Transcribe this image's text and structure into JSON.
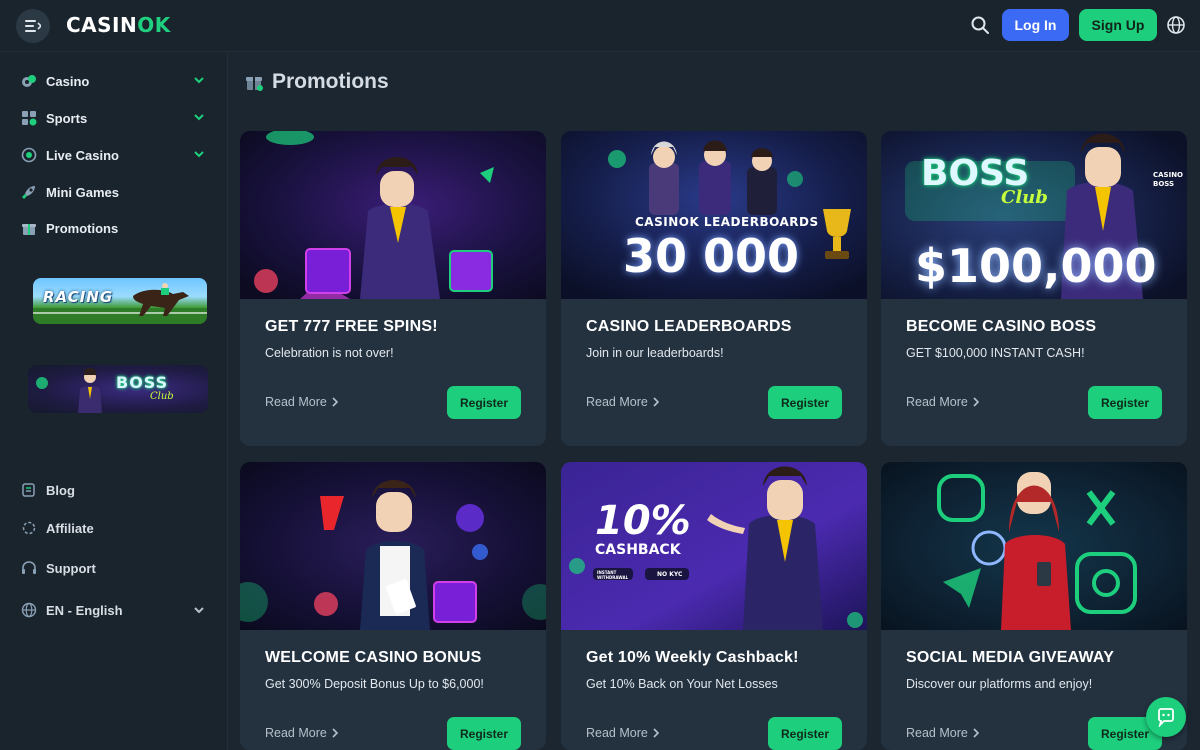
{
  "header": {
    "logo_white": "CASIN",
    "logo_green": "OK",
    "login_label": "Log In",
    "signup_label": "Sign Up"
  },
  "sidebar": {
    "items": [
      {
        "label": "Casino",
        "icon": "casino-chip-icon"
      },
      {
        "label": "Sports",
        "icon": "sports-icon"
      },
      {
        "label": "Live Casino",
        "icon": "live-casino-icon"
      },
      {
        "label": "Mini Games",
        "icon": "rocket-icon"
      },
      {
        "label": "Promotions",
        "icon": "gift-icon"
      }
    ],
    "banners": {
      "racing": "RACING",
      "boss": "BOSS",
      "boss_club": "Club"
    },
    "bottom_items": [
      {
        "label": "Blog",
        "icon": "blog-icon"
      },
      {
        "label": "Affiliate",
        "icon": "affiliate-icon"
      },
      {
        "label": "Support",
        "icon": "headset-icon"
      },
      {
        "label": "EN - English",
        "icon": "globe-icon"
      }
    ]
  },
  "main": {
    "title": "Promotions",
    "read_more_label": "Read More",
    "register_label": "Register",
    "cards": [
      {
        "title": "GET 777 FREE SPINS!",
        "subtitle": "Celebration is not over!"
      },
      {
        "title": "CASINO LEADERBOARDS",
        "subtitle": "Join in our leaderboards!",
        "img_brand": "CASINOK LEADERBOARDS",
        "img_amount": "30 000"
      },
      {
        "title": "BECOME CASINO BOSS",
        "subtitle": "GET $100,000 INSTANT CASH!",
        "img_boss": "BOSS",
        "img_club": "Club",
        "img_tag": "CASINO BOSS",
        "img_amount": "$100,000"
      },
      {
        "title": "WELCOME CASINO BONUS",
        "subtitle": "Get 300% Deposit Bonus Up to $6,000!"
      },
      {
        "title": "Get 10% Weekly Cashback!",
        "subtitle": "Get 10% Back on Your Net Losses",
        "img_percent": "10%",
        "img_cashback": "CASHBACK",
        "img_pill1": "INSTANT WITHDRAWAL",
        "img_pill2": "NO KYC"
      },
      {
        "title": "SOCIAL MEDIA GIVEAWAY",
        "subtitle": "Discover our platforms and enjoy!"
      }
    ]
  },
  "colors": {
    "background": "#1c2630",
    "sidebar": "#1a242d",
    "card": "#243240",
    "accent_green": "#1dcf7d",
    "login_blue": "#3b6bf4"
  }
}
